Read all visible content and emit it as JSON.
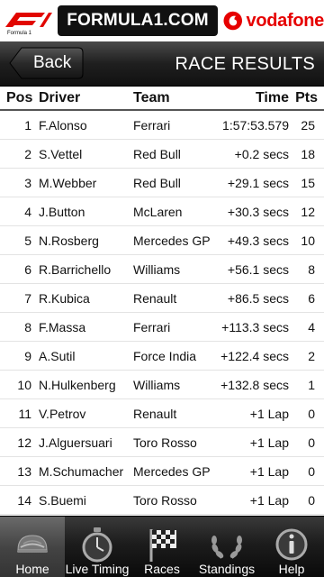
{
  "banner": {
    "f1_logo_text": "F1",
    "f1_logo_sub": "Formula 1",
    "site": "FORMULA1.COM",
    "sponsor": "vodafone"
  },
  "header": {
    "back_label": "Back",
    "title": "RACE RESULTS"
  },
  "table": {
    "columns": {
      "pos": "Pos",
      "driver": "Driver",
      "team": "Team",
      "time": "Time",
      "pts": "Pts"
    },
    "rows": [
      {
        "pos": "1",
        "driver": "F.Alonso",
        "team": "Ferrari",
        "time": "1:57:53.579",
        "pts": "25"
      },
      {
        "pos": "2",
        "driver": "S.Vettel",
        "team": "Red Bull",
        "time": "+0.2 secs",
        "pts": "18"
      },
      {
        "pos": "3",
        "driver": "M.Webber",
        "team": "Red Bull",
        "time": "+29.1 secs",
        "pts": "15"
      },
      {
        "pos": "4",
        "driver": "J.Button",
        "team": "McLaren",
        "time": "+30.3 secs",
        "pts": "12"
      },
      {
        "pos": "5",
        "driver": "N.Rosberg",
        "team": "Mercedes GP",
        "time": "+49.3 secs",
        "pts": "10"
      },
      {
        "pos": "6",
        "driver": "R.Barrichello",
        "team": "Williams",
        "time": "+56.1 secs",
        "pts": "8"
      },
      {
        "pos": "7",
        "driver": "R.Kubica",
        "team": "Renault",
        "time": "+86.5 secs",
        "pts": "6"
      },
      {
        "pos": "8",
        "driver": "F.Massa",
        "team": "Ferrari",
        "time": "+113.3 secs",
        "pts": "4"
      },
      {
        "pos": "9",
        "driver": "A.Sutil",
        "team": "Force India",
        "time": "+122.4 secs",
        "pts": "2"
      },
      {
        "pos": "10",
        "driver": "N.Hulkenberg",
        "team": "Williams",
        "time": "+132.8 secs",
        "pts": "1"
      },
      {
        "pos": "11",
        "driver": "V.Petrov",
        "team": "Renault",
        "time": "+1 Lap",
        "pts": "0"
      },
      {
        "pos": "12",
        "driver": "J.Alguersuari",
        "team": "Toro Rosso",
        "time": "+1 Lap",
        "pts": "0"
      },
      {
        "pos": "13",
        "driver": "M.Schumacher",
        "team": "Mercedes GP",
        "time": "+1 Lap",
        "pts": "0"
      },
      {
        "pos": "14",
        "driver": "S.Buemi",
        "team": "Toro Rosso",
        "time": "+1 Lap",
        "pts": "0"
      }
    ]
  },
  "tabs": [
    {
      "label": "Home",
      "icon": "helmet-icon",
      "active": true
    },
    {
      "label": "Live Timing",
      "icon": "stopwatch-icon",
      "active": false
    },
    {
      "label": "Races",
      "icon": "checkered-flag-icon",
      "active": false
    },
    {
      "label": "Standings",
      "icon": "laurel-wreath-icon",
      "active": false
    },
    {
      "label": "Help",
      "icon": "info-icon",
      "active": false
    }
  ],
  "colors": {
    "vodafone_red": "#e60000",
    "f1_red": "#e10600",
    "bar_dark": "#111111"
  }
}
